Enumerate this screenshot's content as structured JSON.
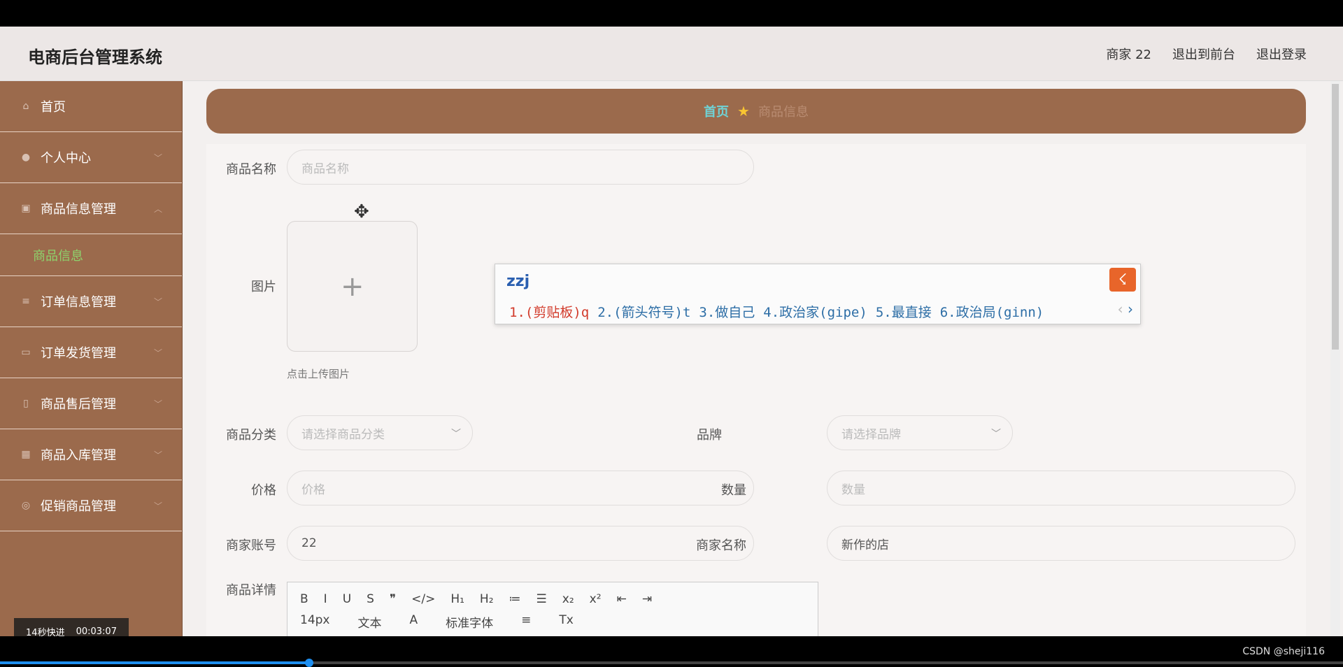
{
  "header": {
    "title": "电商后台管理系统",
    "user_label": "商家 22",
    "exit_front_label": "退出到前台",
    "logout_label": "退出登录"
  },
  "sidebar": {
    "items": [
      {
        "label": "首页",
        "icon": "home-icon"
      },
      {
        "label": "个人中心",
        "icon": "user-icon"
      },
      {
        "label": "商品信息管理",
        "icon": "clipboard-icon"
      },
      {
        "label": "订单信息管理",
        "icon": "list-icon"
      },
      {
        "label": "订单发货管理",
        "icon": "chat-icon"
      },
      {
        "label": "商品售后管理",
        "icon": "mic-icon"
      },
      {
        "label": "商品入库管理",
        "icon": "grid-icon"
      },
      {
        "label": "促销商品管理",
        "icon": "compass-icon"
      }
    ],
    "sub_item_active": "商品信息"
  },
  "breadcrumb": {
    "home": "首页",
    "current": "商品信息"
  },
  "form": {
    "name_label": "商品名称",
    "name_placeholder": "商品名称",
    "image_label": "图片",
    "upload_hint": "点击上传图片",
    "category_label": "商品分类",
    "category_placeholder": "请选择商品分类",
    "brand_label": "品牌",
    "brand_placeholder": "请选择品牌",
    "price_label": "价格",
    "price_placeholder": "价格",
    "qty_label": "数量",
    "qty_placeholder": "数量",
    "merchant_account_label": "商家账号",
    "merchant_account_value": "22",
    "merchant_name_label": "商家名称",
    "merchant_name_value": "新作的店",
    "detail_label": "商品详情"
  },
  "editor": {
    "row1": [
      "B",
      "I",
      "U",
      "S",
      "❞",
      "</>",
      "H₁",
      "H₂",
      "≔",
      "☰",
      "x₂",
      "x²",
      "⇤",
      "⇥"
    ],
    "font_size": "14px",
    "block_type": "文本",
    "font_family": "标准字体"
  },
  "ime": {
    "code": "zzj",
    "candidates": [
      "1.(剪贴板)q",
      "2.(箭头符号)t",
      "3.做自己",
      "4.政治家(gipe)",
      "5.最直接",
      "6.政治局(ginn)"
    ]
  },
  "video": {
    "skip_label": "14秒快进",
    "time": "00:03:07",
    "watermark": "CSDN @sheji116",
    "progress": 0.23
  }
}
